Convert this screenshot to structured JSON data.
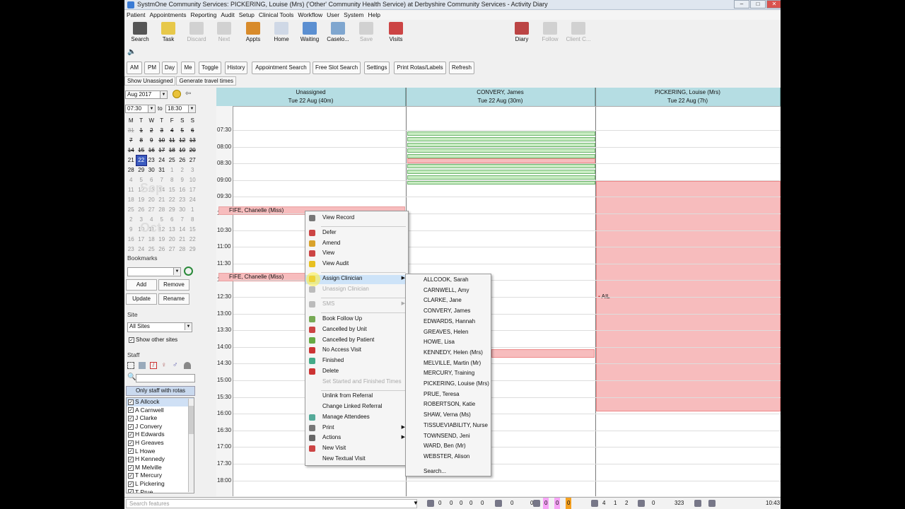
{
  "window": {
    "title": "SystmOne Community Services: PICKERING, Louise (Mrs) ('Other' Community Health Service) at Derbyshire Community Services - Activity Diary"
  },
  "menubar": [
    "Patient",
    "Appointments",
    "Reporting",
    "Audit",
    "Setup",
    "Clinical Tools",
    "Workflow",
    "User",
    "System",
    "Help"
  ],
  "toolbar": {
    "items": [
      {
        "label": "Search",
        "icon": "search-icon",
        "color": "#555"
      },
      {
        "label": "Task",
        "icon": "task-icon",
        "color": "#e7c84a"
      },
      {
        "label": "Discard",
        "icon": "discard-icon",
        "color": "#999"
      },
      {
        "label": "Next",
        "icon": "next-icon",
        "color": "#999"
      },
      {
        "label": "Appts",
        "icon": "appts-icon",
        "color": "#d88b2b"
      },
      {
        "label": "Home",
        "icon": "home-icon",
        "color": "#cfd8e6"
      },
      {
        "label": "Waiting",
        "icon": "waiting-icon",
        "color": "#5b8fd1"
      },
      {
        "label": "Caselo...",
        "icon": "caseload-icon",
        "color": "#7fa6cf"
      },
      {
        "label": "Save",
        "icon": "save-icon",
        "color": "#999"
      },
      {
        "label": "Visits",
        "icon": "visits-icon",
        "color": "#c44"
      },
      {
        "label": "Diary",
        "icon": "diary-icon",
        "color": "#b44"
      },
      {
        "label": "Follow",
        "icon": "follow-icon",
        "color": "#999"
      },
      {
        "label": "Client C...",
        "icon": "client-icon",
        "color": "#999"
      }
    ]
  },
  "buttons": [
    "AM",
    "PM",
    "Day",
    "Me",
    "Toggle",
    "History",
    "Appointment Search",
    "Free Slot Search",
    "Settings",
    "Print Rotas/Labels",
    "Refresh"
  ],
  "tabs2": [
    "Show Unassigned",
    "Generate travel times"
  ],
  "left": {
    "month": "Aug 2017",
    "from_time": "07:30",
    "to_label": "to",
    "to_time": "18:30",
    "weekdays": [
      "M",
      "T",
      "W",
      "T",
      "F",
      "S",
      "S"
    ],
    "weeks": [
      [
        "31",
        "1",
        "2",
        "3",
        "4",
        "5",
        "6"
      ],
      [
        "7",
        "8",
        "9",
        "10",
        "11",
        "12",
        "13"
      ],
      [
        "14",
        "15",
        "16",
        "17",
        "18",
        "19",
        "20"
      ],
      [
        "21",
        "22",
        "23",
        "24",
        "25",
        "26",
        "27"
      ],
      [
        "28",
        "29",
        "30",
        "31",
        "1",
        "2",
        "3"
      ],
      [
        "4",
        "5",
        "6",
        "7",
        "8",
        "9",
        "10"
      ],
      [
        "11",
        "12",
        "13",
        "14",
        "15",
        "16",
        "17"
      ],
      [
        "18",
        "19",
        "20",
        "21",
        "22",
        "23",
        "24"
      ],
      [
        "25",
        "26",
        "27",
        "28",
        "29",
        "30",
        "1"
      ],
      [
        "2",
        "3",
        "4",
        "5",
        "6",
        "7",
        "8"
      ],
      [
        "9",
        "10",
        "11",
        "12",
        "13",
        "14",
        "15"
      ],
      [
        "16",
        "17",
        "18",
        "19",
        "20",
        "21",
        "22"
      ],
      [
        "23",
        "24",
        "25",
        "26",
        "27",
        "28",
        "29"
      ]
    ],
    "month_labels": [
      "Sep",
      "Oct"
    ],
    "bookmarks_label": "Bookmarks",
    "bm_buttons": [
      "Add",
      "Remove",
      "Update",
      "Rename"
    ],
    "site_label": "Site",
    "site_value": "All Sites",
    "show_other_sites": "Show other sites",
    "staff_label": "Staff",
    "only_staff": "Only staff with rotas",
    "staff": [
      "S Allcock",
      "A Carnwell",
      "J Clarke",
      "J Convery",
      "H Edwards",
      "H Greaves",
      "L Howe",
      "H Kennedy",
      "M Melville",
      "T Mercury",
      "L Pickering",
      "T Prue"
    ]
  },
  "columns": [
    {
      "name": "Unassigned",
      "date": "Tue 22 Aug (40m)"
    },
    {
      "name": "CONVERY, James",
      "date": "Tue 22 Aug (30m)"
    },
    {
      "name": "PICKERING, Louise (Mrs)",
      "date": "Tue 22 Aug (7h)"
    }
  ],
  "times": [
    "07:30",
    "08:00",
    "08:30",
    "09:00",
    "09:30",
    "10:00",
    "10:30",
    "11:00",
    "11:30",
    "12:00",
    "12:30",
    "13:00",
    "13:30",
    "14:00",
    "14:30",
    "15:00",
    "15:30",
    "16:00",
    "16:30",
    "17:00",
    "17:30",
    "18:00"
  ],
  "appointments": [
    "FIFE, Chanelle (Miss)",
    "FIFE, Chanelle (Miss)"
  ],
  "ail": "AIL",
  "context_menu": [
    {
      "label": "View Record",
      "icon": "view-record-icon",
      "color": "#777"
    },
    {
      "label": "Defer",
      "icon": "defer-icon",
      "color": "#c44"
    },
    {
      "label": "Amend",
      "icon": "amend-icon",
      "color": "#d9a22a"
    },
    {
      "label": "View",
      "icon": "view-icon",
      "color": "#c44"
    },
    {
      "label": "View Audit",
      "icon": "audit-icon",
      "color": "#e8c020"
    },
    {
      "label": "Assign Clinician",
      "icon": "assign-icon",
      "color": "#d9b032"
    },
    {
      "label": "Unassign Clinician",
      "icon": "unassign-icon",
      "color": "#bbb"
    },
    {
      "label": "SMS",
      "icon": "sms-icon",
      "color": "#bbb"
    },
    {
      "label": "Book Follow Up",
      "icon": "follow-up-icon",
      "color": "#7a5"
    },
    {
      "label": "Cancelled by Unit",
      "icon": "cancel-unit-icon",
      "color": "#c44"
    },
    {
      "label": "Cancelled by Patient",
      "icon": "cancel-patient-icon",
      "color": "#6a4"
    },
    {
      "label": "No Access Visit",
      "icon": "no-access-icon",
      "color": "#c33"
    },
    {
      "label": "Finished",
      "icon": "finished-icon",
      "color": "#4a8"
    },
    {
      "label": "Delete",
      "icon": "delete-icon",
      "color": "#c33"
    },
    {
      "label": "Set Started and Finished Times",
      "icon": "",
      "color": ""
    },
    {
      "label": "Unlink from Referral",
      "icon": "",
      "color": ""
    },
    {
      "label": "Change Linked Referral",
      "icon": "",
      "color": ""
    },
    {
      "label": "Manage Attendees",
      "icon": "attendees-icon",
      "color": "#5a9"
    },
    {
      "label": "Print",
      "icon": "print-icon",
      "color": "#777"
    },
    {
      "label": "Actions",
      "icon": "actions-icon",
      "color": "#666"
    },
    {
      "label": "New Visit",
      "icon": "new-visit-icon",
      "color": "#c44"
    },
    {
      "label": "New Textual Visit",
      "icon": "",
      "color": ""
    }
  ],
  "submenu": [
    "ALLCOOK, Sarah",
    "CARNWELL, Amy",
    "CLARKE, Jane",
    "CONVERY, James",
    "EDWARDS, Hannah",
    "GREAVES, Helen",
    "HOWE, Lisa",
    "KENNEDY, Helen (Mrs)",
    "MELVILLE, Martin (Mr)",
    "MERCURY, Training",
    "PICKERING, Louise (Mrs)",
    "PRUE, Teresa",
    "ROBERTSON, Katie",
    "SHAW, Verna (Ms)",
    "TISSUEVIABILITY, Nurse",
    "TOWNSEND, Jeni",
    "WARD, Ben (Mr)",
    "WEBSTER, Alison",
    "Search..."
  ],
  "status": {
    "search_placeholder": "Search features",
    "counts": [
      "0",
      "0",
      "0",
      "0",
      "0",
      "0",
      "0",
      "0",
      "0",
      "0",
      "0",
      "4",
      "1",
      "2",
      "0",
      "0",
      "323"
    ],
    "time": "10:43"
  }
}
